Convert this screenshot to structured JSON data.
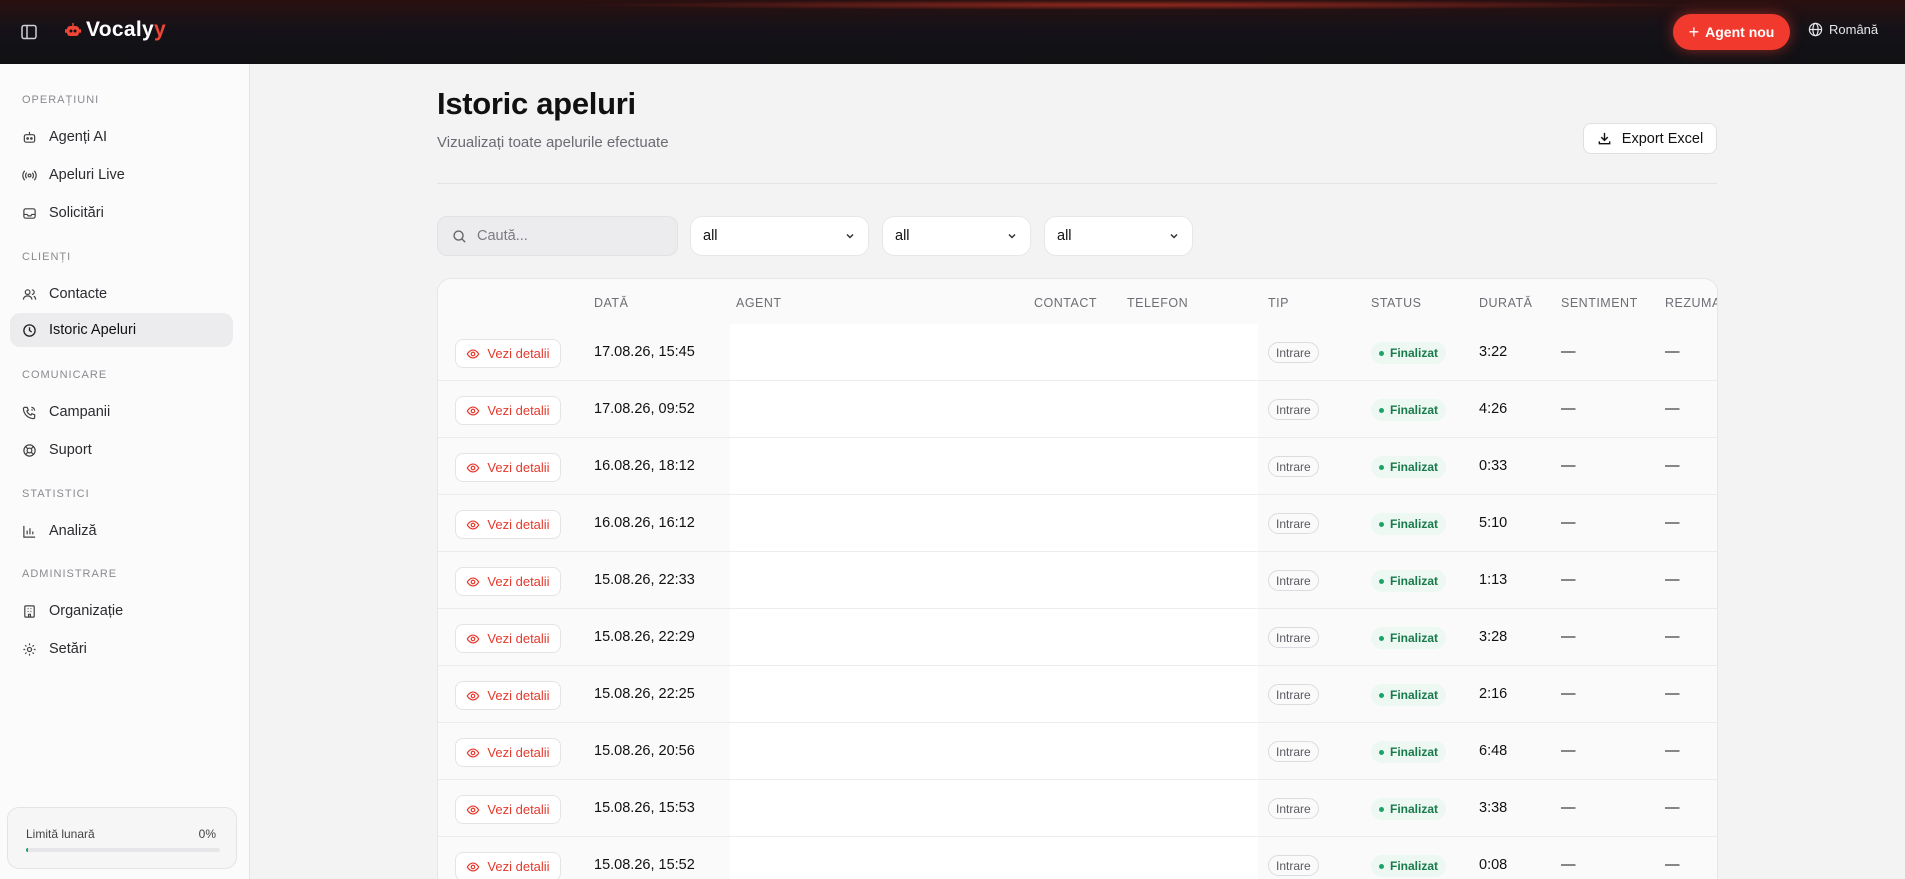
{
  "app": {
    "logo_main": "Vocaly",
    "logo_accent": "y"
  },
  "topbar": {
    "new_agent_label": "Agent nou",
    "language_label": "Română"
  },
  "sidebar": {
    "sections": [
      {
        "title": "OPERAȚIUNI",
        "items": [
          {
            "label": "Agenți AI",
            "icon": "robot-icon"
          },
          {
            "label": "Apeluri Live",
            "icon": "radio-icon"
          },
          {
            "label": "Solicitări",
            "icon": "inbox-icon"
          }
        ]
      },
      {
        "title": "CLIENȚI",
        "items": [
          {
            "label": "Contacte",
            "icon": "users-icon"
          },
          {
            "label": "Istoric Apeluri",
            "icon": "clock-icon",
            "active": true
          }
        ]
      },
      {
        "title": "COMUNICARE",
        "items": [
          {
            "label": "Campanii",
            "icon": "phone-icon"
          },
          {
            "label": "Suport",
            "icon": "lifebuoy-icon"
          }
        ]
      },
      {
        "title": "STATISTICI",
        "items": [
          {
            "label": "Analiză",
            "icon": "bar-chart-icon"
          }
        ]
      },
      {
        "title": "ADMINISTRARE",
        "items": [
          {
            "label": "Organizație",
            "icon": "building-icon"
          },
          {
            "label": "Setări",
            "icon": "gear-icon"
          }
        ]
      }
    ],
    "limit": {
      "label": "Limită lunară",
      "value": "0%",
      "fraction": 0.0
    }
  },
  "main": {
    "title": "Istoric apeluri",
    "subtitle": "Vizualizați toate apelurile efectuate",
    "export_label": "Export Excel",
    "search_placeholder": "Caută...",
    "filters": [
      "all",
      "all",
      "all"
    ]
  },
  "table": {
    "headers": [
      "DATĂ",
      "AGENT",
      "CONTACT",
      "TELEFON",
      "TIP",
      "STATUS",
      "DURATĂ",
      "SENTIMENT",
      "REZUMA"
    ],
    "details_label": "Vezi detalii",
    "rows": [
      {
        "date": "17.08.26, 15:45",
        "tip": "Intrare",
        "status": "Finalizat",
        "duration": "3:22",
        "sentiment": "—",
        "summary": "—"
      },
      {
        "date": "17.08.26, 09:52",
        "tip": "Intrare",
        "status": "Finalizat",
        "duration": "4:26",
        "sentiment": "—",
        "summary": "—"
      },
      {
        "date": "16.08.26, 18:12",
        "tip": "Intrare",
        "status": "Finalizat",
        "duration": "0:33",
        "sentiment": "—",
        "summary": "—"
      },
      {
        "date": "16.08.26, 16:12",
        "tip": "Intrare",
        "status": "Finalizat",
        "duration": "5:10",
        "sentiment": "—",
        "summary": "—"
      },
      {
        "date": "15.08.26, 22:33",
        "tip": "Intrare",
        "status": "Finalizat",
        "duration": "1:13",
        "sentiment": "—",
        "summary": "—"
      },
      {
        "date": "15.08.26, 22:29",
        "tip": "Intrare",
        "status": "Finalizat",
        "duration": "3:28",
        "sentiment": "—",
        "summary": "—"
      },
      {
        "date": "15.08.26, 22:25",
        "tip": "Intrare",
        "status": "Finalizat",
        "duration": "2:16",
        "sentiment": "—",
        "summary": "—"
      },
      {
        "date": "15.08.26, 20:56",
        "tip": "Intrare",
        "status": "Finalizat",
        "duration": "6:48",
        "sentiment": "—",
        "summary": "—"
      },
      {
        "date": "15.08.26, 15:53",
        "tip": "Intrare",
        "status": "Finalizat",
        "duration": "3:38",
        "sentiment": "—",
        "summary": "—"
      },
      {
        "date": "15.08.26, 15:52",
        "tip": "Intrare",
        "status": "Finalizat",
        "duration": "0:08",
        "sentiment": "—",
        "summary": "—"
      }
    ]
  },
  "colors": {
    "accent": "#f13a2d",
    "status_green": "#1a7a4c",
    "topbar_bg": "#111114"
  }
}
